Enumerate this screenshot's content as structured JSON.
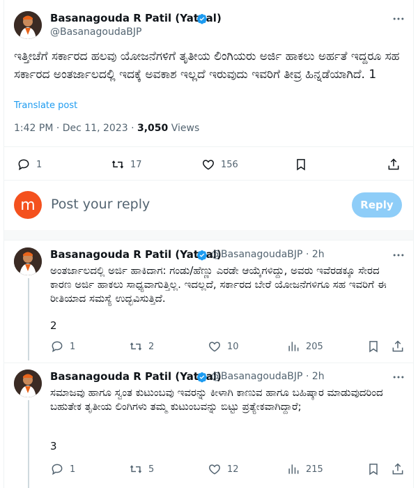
{
  "main_tweet": {
    "author_name": "Basanagouda R Patil (Yatnal)",
    "author_handle": "@BasanagoudaBJP",
    "text": "ಇತ್ತೀಚೆಗೆ ಸರ್ಕಾರದ ಹಲವು ಯೋಜನೆಗಳಿಗೆ ತೃತೀಯ ಲಿಂಗಿಯರು ಅರ್ಜಿ ಹಾಕಲು ಅರ್ಹತೆ ಇದ್ದರೂ ಸಹ ಸರ್ಕಾರದ ಅಂತರ್ಜಾಲದಲ್ಲಿ ಇದಕ್ಕೆ ಅವಕಾಶ ಇಲ್ಲದೆ ಇರುವುದು ಇವರಿಗೆ ತೀವ್ರ ಹಿನ್ನಡೆಯಾಗಿದೆ. 1",
    "translate_label": "Translate post",
    "time": "1:42 PM · Dec 11, 2023 · ",
    "views_count": "3,050",
    "views_label": " Views",
    "actions": {
      "replies": "1",
      "reposts": "17",
      "likes": "156"
    }
  },
  "composer": {
    "avatar_letter": "m",
    "placeholder": "Post your reply",
    "reply_label": "Reply"
  },
  "thread": [
    {
      "author_name": "Basanagouda R Patil (Yatnal)",
      "author_handle": "@BasanagoudaBJP",
      "time": "· 2h",
      "text": "ಅಂತರ್ಜಾಲದಲ್ಲಿ ಅರ್ಜಿ ಹಾಕಿದಾಗ: ಗಂಡು/ಹೆಣ್ಣು ಎರಡೇ ಆಯ್ಕೆಗಳಿದ್ದು, ಅವರು ಇವೆರಡಕ್ಕೂ ಸೇರದ ಕಾರಣ ಅರ್ಜಿ ಹಾಕಲು ಸಾಧ್ಯವಾಗುತ್ತಿಲ್ಲ. ಇದಲ್ಲದೆ, ಸರ್ಕಾರದ ಬೇರೆ ಯೋಜನೆಗಳಿಗೂ ಸಹ ಇವರಿಗೆ ಈ ರೀತಿಯಾದ ಸಮಸ್ಯೆ ಉದ್ಭವಿಸುತ್ತಿದೆ.",
      "number": "2",
      "replies": "1",
      "reposts": "2",
      "likes": "10",
      "views": "205"
    },
    {
      "author_name": "Basanagouda R Patil (Yatnal)",
      "author_handle": "@BasanagoudaBJP",
      "time": "· 2h",
      "text": "ಸಮಾಜವು ಹಾಗೂ ಸ್ವಂತ ಕುಟುಂಬವು ಇವರನ್ನು ಕೀಳಾಗಿ ಕಾಣುವ ಹಾಗೂ ಬಹಿಷ್ಕಾರ ಮಾಡುವುದರಿಂದ ಬಹುತೇಕ ತೃತೀಯ ಲಿಂಗಿಗಳು ತಮ್ಮ ಕುಟುಂಬವನ್ನು ಬಿಟ್ಟು ಪ್ರತ್ಯೇಕವಾಗಿದ್ದಾರೆ;",
      "number": "3",
      "replies": "1",
      "reposts": "5",
      "likes": "12",
      "views": "215"
    }
  ],
  "colors": {
    "accent": "#1d9bf0",
    "reply_button": "#8ecdf8",
    "muted_text": "#536471",
    "composer_avatar": "#f4511e"
  },
  "icons": [
    "avatar-photo",
    "verified-badge-icon",
    "more-icon",
    "reply-icon",
    "repost-icon",
    "like-icon",
    "bookmark-icon",
    "share-icon",
    "views-icon"
  ]
}
